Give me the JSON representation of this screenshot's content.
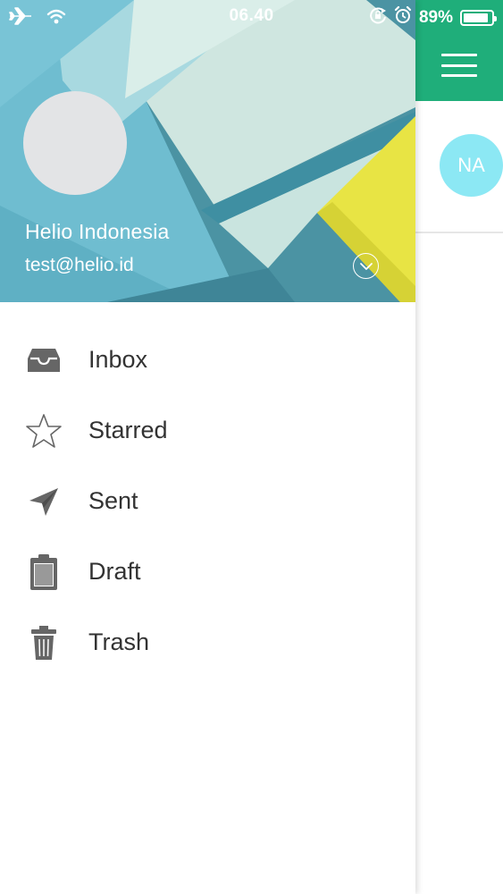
{
  "status_bar": {
    "time": "06.40",
    "battery_text": "89%",
    "battery_level": 0.89,
    "icons": [
      "airplane-icon",
      "wifi-icon",
      "rotation-lock-icon",
      "alarm-icon",
      "battery-icon"
    ]
  },
  "header": {
    "name": "Helio Indonesia",
    "email": "test@helio.id",
    "toggle_icon": "chevron-down-icon"
  },
  "menu": {
    "items": [
      {
        "label": "Inbox",
        "icon": "inbox-icon"
      },
      {
        "label": "Starred",
        "icon": "star-icon"
      },
      {
        "label": "Sent",
        "icon": "send-icon"
      },
      {
        "label": "Draft",
        "icon": "clipboard-icon"
      },
      {
        "label": "Trash",
        "icon": "trash-icon"
      }
    ]
  },
  "background_app": {
    "menu_icon": "hamburger-menu-icon",
    "avatar_initials": "NA"
  },
  "colors": {
    "appbar": "#1fae7a",
    "header_blue": "#6fbdd0",
    "accent_yellow": "#e8e444",
    "avatar_na": "#8ce8f4",
    "icon_gray": "#666666",
    "text_dark": "#333333"
  }
}
